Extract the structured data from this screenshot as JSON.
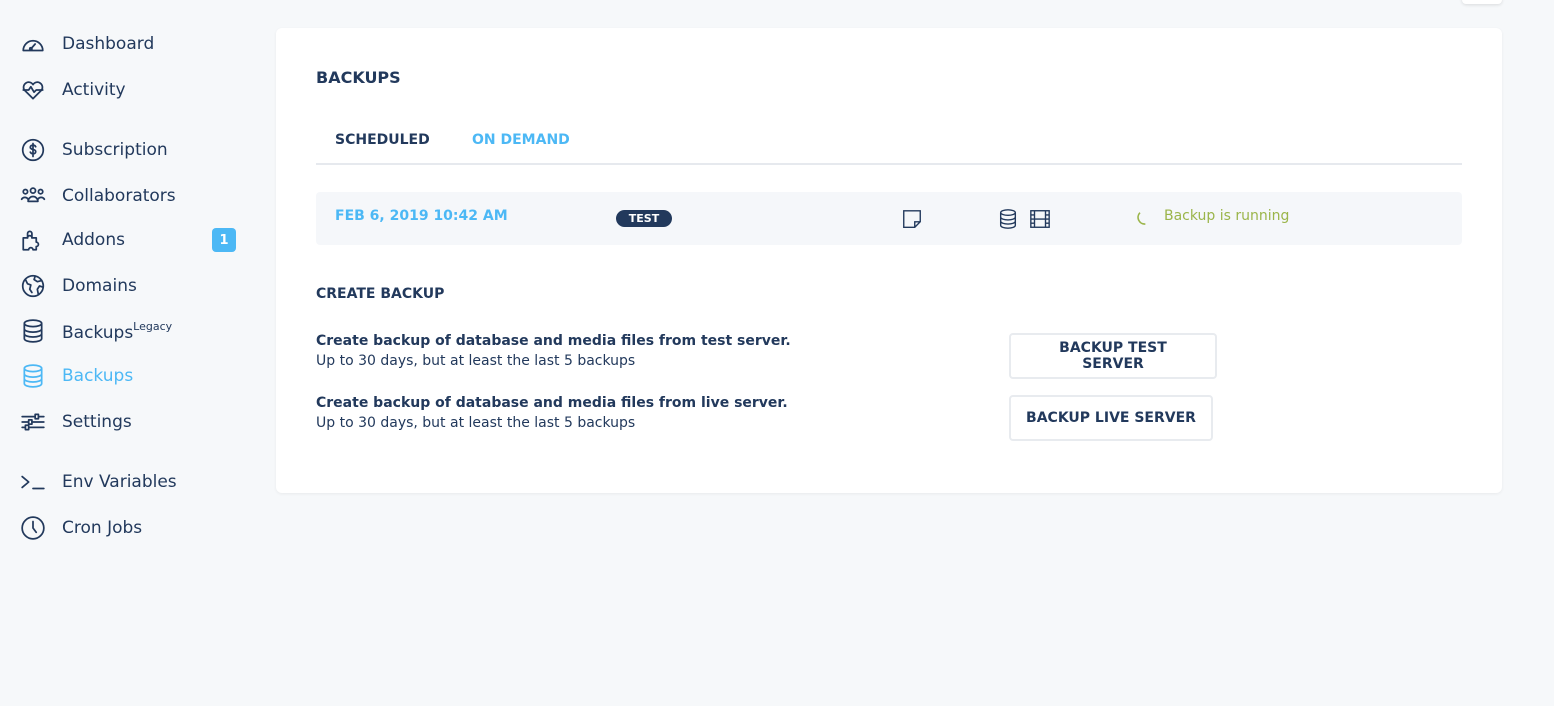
{
  "sidebar": {
    "items": [
      {
        "label": "Dashboard",
        "icon": "gauge-icon"
      },
      {
        "label": "Activity",
        "icon": "heart-pulse-icon"
      },
      {
        "label": "Subscription",
        "icon": "dollar-circle-icon"
      },
      {
        "label": "Collaborators",
        "icon": "users-icon"
      },
      {
        "label": "Addons",
        "icon": "puzzle-icon",
        "badge": "1"
      },
      {
        "label": "Domains",
        "icon": "globe-icon"
      },
      {
        "label": "Backups",
        "sup": "Legacy",
        "icon": "database-icon"
      },
      {
        "label": "Backups",
        "icon": "database-icon",
        "active": true
      },
      {
        "label": "Settings",
        "icon": "sliders-icon"
      },
      {
        "label": "Env Variables",
        "icon": "terminal-icon"
      },
      {
        "label": "Cron Jobs",
        "icon": "clock-icon"
      }
    ]
  },
  "main": {
    "title": "BACKUPS",
    "tabs": [
      {
        "label": "SCHEDULED",
        "active": true
      },
      {
        "label": "ON DEMAND"
      }
    ],
    "backup": {
      "date": "FEB 6, 2019 10:42 AM",
      "tag": "TEST",
      "status": "Backup is running"
    },
    "create": {
      "title": "CREATE BACKUP",
      "items": [
        {
          "title": "Create backup of database and media files from test server.",
          "note": "Up to 30 days, but at least the last 5 backups",
          "button": "BACKUP TEST SERVER"
        },
        {
          "title": "Create backup of database and media files from live server.",
          "note": "Up to 30 days, but at least the last 5 backups",
          "button": "BACKUP LIVE SERVER"
        }
      ]
    }
  },
  "colors": {
    "text": "#22395c",
    "accent": "#4cb8f5",
    "running": "#9bb54a",
    "background": "#f6f8fa"
  }
}
